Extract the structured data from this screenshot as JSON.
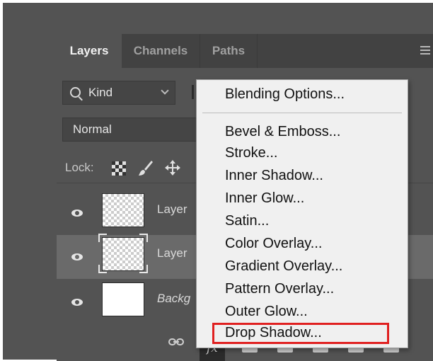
{
  "panel": {
    "tabs": [
      {
        "label": "Layers",
        "active": true
      },
      {
        "label": "Channels",
        "active": false
      },
      {
        "label": "Paths",
        "active": false
      }
    ]
  },
  "filter": {
    "kind_label": "Kind"
  },
  "blend": {
    "mode": "Normal"
  },
  "lock": {
    "label": "Lock:"
  },
  "layers": [
    {
      "name": "Layer",
      "thumbnail": "transparent",
      "visible": true,
      "selected": false
    },
    {
      "name": "Layer",
      "thumbnail": "transparent",
      "visible": true,
      "selected": true
    },
    {
      "name": "Backg",
      "thumbnail": "white",
      "visible": true,
      "selected": false
    }
  ],
  "footer": {
    "fx_label": "fx"
  },
  "context_menu": {
    "items": [
      "Blending Options...",
      "Bevel & Emboss...",
      "Stroke...",
      "Inner Shadow...",
      "Inner Glow...",
      "Satin...",
      "Color Overlay...",
      "Gradient Overlay...",
      "Pattern Overlay...",
      "Outer Glow...",
      "Drop Shadow..."
    ],
    "highlighted": "Drop Shadow..."
  },
  "colors": {
    "panel_bg": "#535353",
    "tab_bar_bg": "#424242",
    "selected_row": "#6a6a6a",
    "menu_bg": "#f0f0f0",
    "highlight": "#e02020"
  }
}
